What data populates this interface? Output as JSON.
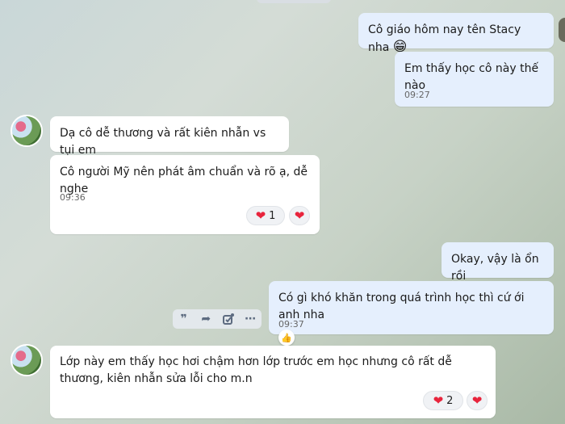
{
  "messages": [
    {
      "text": "Cô giáo hôm nay tên Stacy nha",
      "emoji": "😁"
    },
    {
      "text": "Em thấy học cô này thế nào",
      "time": "09:27"
    },
    {
      "text": "Dạ cô dễ thương và rất kiên nhẫn vs tụi em"
    },
    {
      "text": "Cô người Mỹ nên phát âm chuẩn và rõ ạ, dễ nghe",
      "time": "09:36",
      "reaction_count": "1"
    },
    {
      "text": "Okay, vậy là ổn rồi"
    },
    {
      "text": "Có gì khó khăn trong quá trình học thì cứ ới anh nha",
      "time": "09:37"
    },
    {
      "text": "Lớp này em thấy học hơi chậm hơn lớp trước em học nhưng cô rất dễ thương, kiên nhẫn sửa lỗi cho m.n",
      "reaction_count": "2"
    }
  ],
  "toolbar_icons": [
    "quote-icon",
    "forward-icon",
    "task-icon",
    "more-icon"
  ],
  "colors": {
    "outgoing": "#e5effd",
    "incoming": "#ffffff",
    "heart": "#e8243c"
  }
}
